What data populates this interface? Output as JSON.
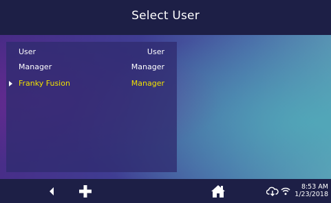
{
  "header": {
    "title": "Select User"
  },
  "user_list": {
    "columns": {
      "name": "User",
      "role": "User"
    },
    "users": [
      {
        "name": "Manager",
        "role": "Manager",
        "selected": false
      },
      {
        "name": "Franky Fusion",
        "role": "Manager",
        "selected": true
      }
    ]
  },
  "footer": {
    "back_icon": "back-arrow-icon",
    "add_icon": "plus-icon",
    "home_icon": "home-icon",
    "cloud_icon": "cloud-sync-icon",
    "wifi_icon": "wifi-icon",
    "time": "8:53 AM",
    "date": "1/23/2018"
  },
  "colors": {
    "header_bg": "#1d1f46",
    "footer_bg": "#1d1f46",
    "selected_text": "#f1e100",
    "text": "#ffffff"
  }
}
